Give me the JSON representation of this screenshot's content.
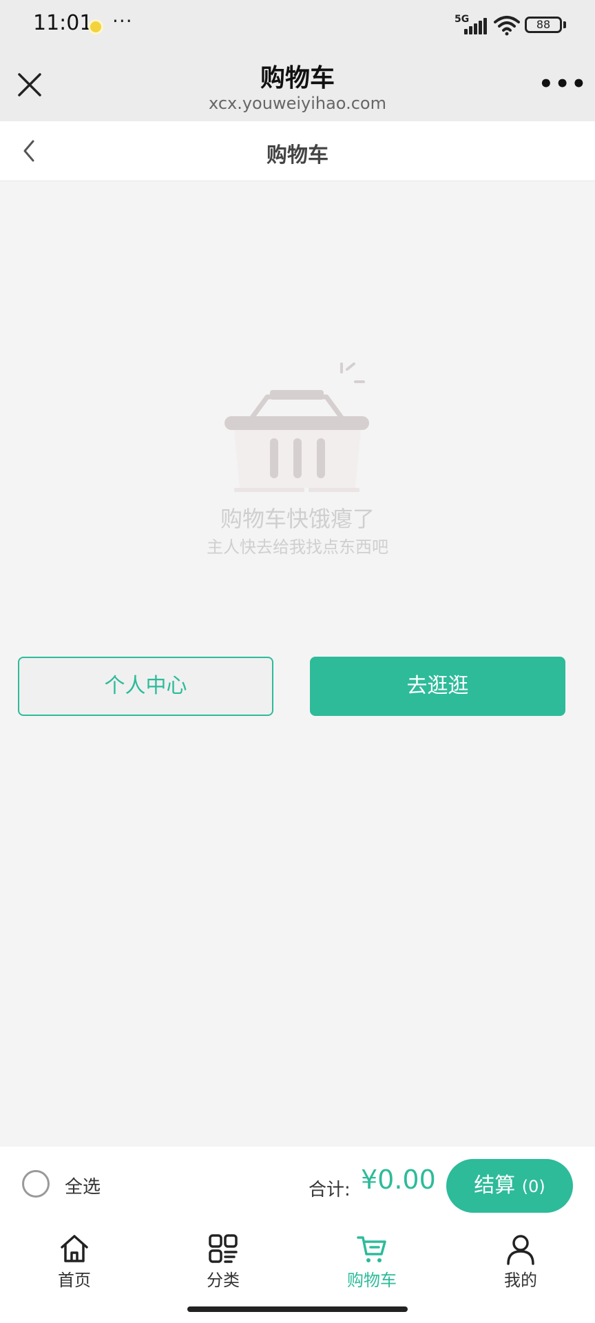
{
  "status": {
    "time": "11:01",
    "network": "5G",
    "battery": "88"
  },
  "header": {
    "title": "购物车",
    "subtitle": "xcx.youweiyihao.com"
  },
  "page": {
    "title": "购物车"
  },
  "empty": {
    "title": "购物车快饿瘪了",
    "subtitle": "主人快去给我找点东西吧"
  },
  "buttons": {
    "profile": "个人中心",
    "browse": "去逛逛"
  },
  "checkout": {
    "select_all": "全选",
    "total_label": "合计:",
    "total_value": "¥0.00",
    "pay_label": "结算",
    "pay_count": "(0)"
  },
  "tabs": [
    {
      "label": "首页",
      "icon": "home-icon",
      "active": false
    },
    {
      "label": "分类",
      "icon": "category-icon",
      "active": false
    },
    {
      "label": "购物车",
      "icon": "cart-icon",
      "active": true
    },
    {
      "label": "我的",
      "icon": "user-icon",
      "active": false
    }
  ],
  "colors": {
    "accent": "#2dbb9a",
    "background": "#f4f4f4",
    "empty_text": "#cfcfcf"
  }
}
